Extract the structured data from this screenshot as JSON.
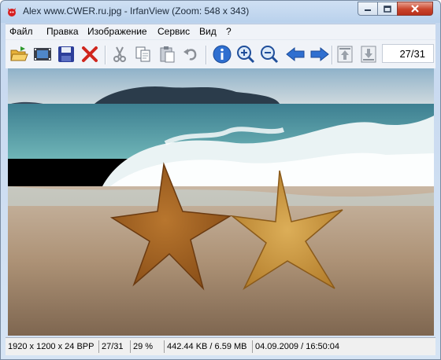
{
  "window": {
    "title": "Alex www.CWER.ru.jpg - IrfanView (Zoom: 548 x 343)",
    "icons": {
      "app": "irfanview-cat-icon",
      "minimize": "minimize-icon",
      "maximize": "maximize-icon",
      "close": "close-icon"
    }
  },
  "menu": {
    "items": [
      {
        "label": "Файл"
      },
      {
        "label": "Правка"
      },
      {
        "label": "Изображение"
      },
      {
        "label": "Сервис"
      },
      {
        "label": "Вид"
      },
      {
        "label": "?"
      }
    ]
  },
  "toolbar": {
    "buttons": [
      {
        "icon": "open-folder-icon"
      },
      {
        "icon": "slideshow-icon"
      },
      {
        "icon": "save-icon"
      },
      {
        "icon": "delete-icon"
      },
      {
        "icon": "cut-icon"
      },
      {
        "icon": "copy-icon"
      },
      {
        "icon": "paste-icon"
      },
      {
        "icon": "undo-icon"
      },
      {
        "icon": "info-icon"
      },
      {
        "icon": "zoom-in-icon"
      },
      {
        "icon": "zoom-out-icon"
      },
      {
        "icon": "previous-arrow-icon"
      },
      {
        "icon": "next-arrow-icon"
      },
      {
        "icon": "first-file-icon"
      },
      {
        "icon": "last-file-icon"
      }
    ],
    "counter": "27/31"
  },
  "image": {
    "subject": "starfish-on-beach-photo",
    "colors": {
      "sky": "#b7cbd6",
      "sea": "#3f8f9a",
      "sand": "#b49a80",
      "starfish": "#c78a3d"
    }
  },
  "status": {
    "dimensions": "1920 x 1200 x 24 BPP",
    "index": "27/31",
    "zoom": "29 %",
    "filesize": "442.44 KB / 6.59 MB",
    "datetime": "04.09.2009 / 16:50:04"
  }
}
